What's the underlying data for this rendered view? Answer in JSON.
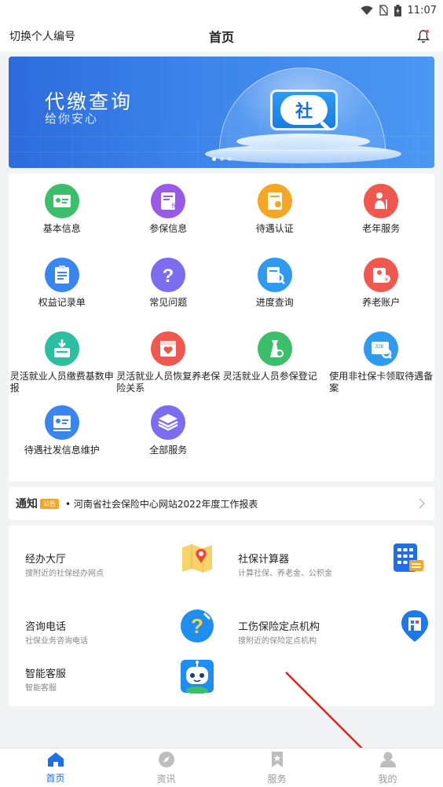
{
  "status_bar": {
    "time": "11:07"
  },
  "header": {
    "switch_label": "切换个人编号",
    "title": "首页"
  },
  "banner": {
    "title": "代缴查询",
    "subtitle": "给你安心",
    "badge_text": "社"
  },
  "services": [
    {
      "label": "基本信息",
      "icon": "id-card-icon",
      "color": "#3bbf6a"
    },
    {
      "label": "参保信息",
      "icon": "insurance-doc-icon",
      "color": "#9a5ae8"
    },
    {
      "label": "待遇认证",
      "icon": "certification-icon",
      "color": "#f5a623"
    },
    {
      "label": "老年服务",
      "icon": "elderly-icon",
      "color": "#f0574f"
    },
    {
      "label": "权益记录单",
      "icon": "record-list-icon",
      "color": "#3a86f0"
    },
    {
      "label": "常见问题",
      "icon": "question-icon",
      "color": "#7b6cf0"
    },
    {
      "label": "进度查询",
      "icon": "progress-search-icon",
      "color": "#2e9bf0"
    },
    {
      "label": "养老账户",
      "icon": "pension-account-icon",
      "color": "#f0574f"
    },
    {
      "label": "灵活就业人员缴费基数申报",
      "icon": "payment-base-icon",
      "color": "#2bbfa0"
    },
    {
      "label": "灵活就业人员恢复养老保险关系",
      "icon": "restore-insurance-icon",
      "color": "#f0574f"
    },
    {
      "label": "灵活就业人员参保登记",
      "icon": "registration-icon",
      "color": "#3bbf6a"
    },
    {
      "label": "使用非社保卡领取待遇备案",
      "icon": "card-filing-icon",
      "color": "#2e9bf0"
    },
    {
      "label": "待遇社发信息维护",
      "icon": "info-maintain-icon",
      "color": "#3a86f0"
    },
    {
      "label": "全部服务",
      "icon": "all-services-icon",
      "color": "#7b6cf0"
    }
  ],
  "notice": {
    "title": "通知",
    "badge": "公告",
    "text": "• 河南省社会保险中心网站2022年度工作报表"
  },
  "quick": [
    {
      "title": "经办大厅",
      "subtitle": "搜附近的社保经办网点",
      "icon": "map-pin-icon"
    },
    {
      "title": "社保计算器",
      "subtitle": "计算社保、养老金、公积金",
      "icon": "calculator-icon"
    },
    {
      "title": "咨询电话",
      "subtitle": "社保业务咨询电话",
      "icon": "help-phone-icon"
    },
    {
      "title": "工伤保险定点机构",
      "subtitle": "搜附近的保险定点机构",
      "icon": "institution-pin-icon"
    },
    {
      "title": "智能客服",
      "subtitle": "智能客服",
      "icon": "robot-icon"
    }
  ],
  "tabs": [
    {
      "label": "首页",
      "icon": "home-icon",
      "active": true
    },
    {
      "label": "资讯",
      "icon": "compass-icon",
      "active": false
    },
    {
      "label": "服务",
      "icon": "bookmark-icon",
      "active": false
    },
    {
      "label": "我的",
      "icon": "person-icon",
      "active": false
    }
  ],
  "colors": {
    "accent": "#1e6fe8",
    "arrow": "#e8221b"
  }
}
